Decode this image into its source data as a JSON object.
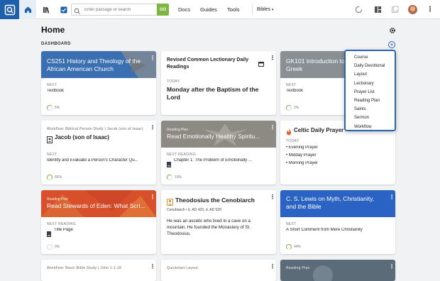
{
  "nav": {
    "search_placeholder": "Enter passage or search",
    "go": "GO",
    "docs": "Docs",
    "guides": "Guides",
    "tools": "Tools",
    "bibles": "Bibles"
  },
  "page": {
    "title": "Home",
    "dashboard": "DASHBOARD"
  },
  "dropdown": [
    "Course",
    "Daily Devotional",
    "Layout",
    "Lectionary",
    "Prayer List",
    "Reading Plan",
    "Saints",
    "Sermon",
    "Workflow"
  ],
  "cards": {
    "c1": {
      "title": "CS251 History and Theology of the African American Church",
      "next": "NEXT",
      "item": "Textbook",
      "progress": "5%"
    },
    "c2": {
      "title": "Revised Common Lectionary Daily Readings",
      "today": "TODAY",
      "item": "Monday after the Baptism of the Lord"
    },
    "c3": {
      "title": "GK101 Introduction to ... Greek",
      "title_a": "GK101 Introduction to",
      "title_b": "Greek",
      "next": "NEXT",
      "item": "Textbook",
      "progress": "2%"
    },
    "c4": {
      "sub": "Workflow: Biblical Person Study | Jacob (son of Isaac)",
      "title": "Jacob (son of Isaac)",
      "next": "NEXT",
      "item": "Identify and Evaluate a Person's Character Qu...",
      "progress": "66%"
    },
    "c5": {
      "sub": "Reading Plan",
      "title": "Read Emotionally Healthy Spiritu...",
      "next": "NEXT READING",
      "item": "Chapter 1: The Problem of Emotionally ...",
      "progress": "10%"
    },
    "c6": {
      "title": "Celtic Daily Prayer",
      "today": "TODAY",
      "items": [
        "• Evening Prayer",
        "• Midday Prayer",
        "• Morning Prayer"
      ]
    },
    "c7": {
      "sub": "Reading Plan",
      "title": "Read Stewards of Eden: What Scri...",
      "next": "NEXT READING",
      "item": "Title Page",
      "progress": "0%"
    },
    "c8": {
      "title": "Theodosius the Cenobiarch",
      "sub": "Cenobiarch • b. AD 423, d. AD 529",
      "desc": "He was an ascetic who lived in a cave on a mountain. He founded the Monastery of St. Theodosius."
    },
    "c9": {
      "title": "C. S. Lewis on Myth, Christianity, and the Bible",
      "next": "NEXT",
      "item": "A Short Comment from Mere Christianity",
      "progress": "44%"
    },
    "c10": {
      "sub": "Workflow: Basic Bible Study | John 1:1-18"
    },
    "c11": {
      "sub": "Quickstart Layout"
    },
    "c12": {
      "sub": "Reading Plan"
    }
  },
  "colors": {
    "brand": "#1f60ad",
    "go": "#7db642",
    "c1": "#3a6fb2",
    "c3": "#8a8f94",
    "c7": "#d8502b",
    "c9": "#2b63c4"
  }
}
